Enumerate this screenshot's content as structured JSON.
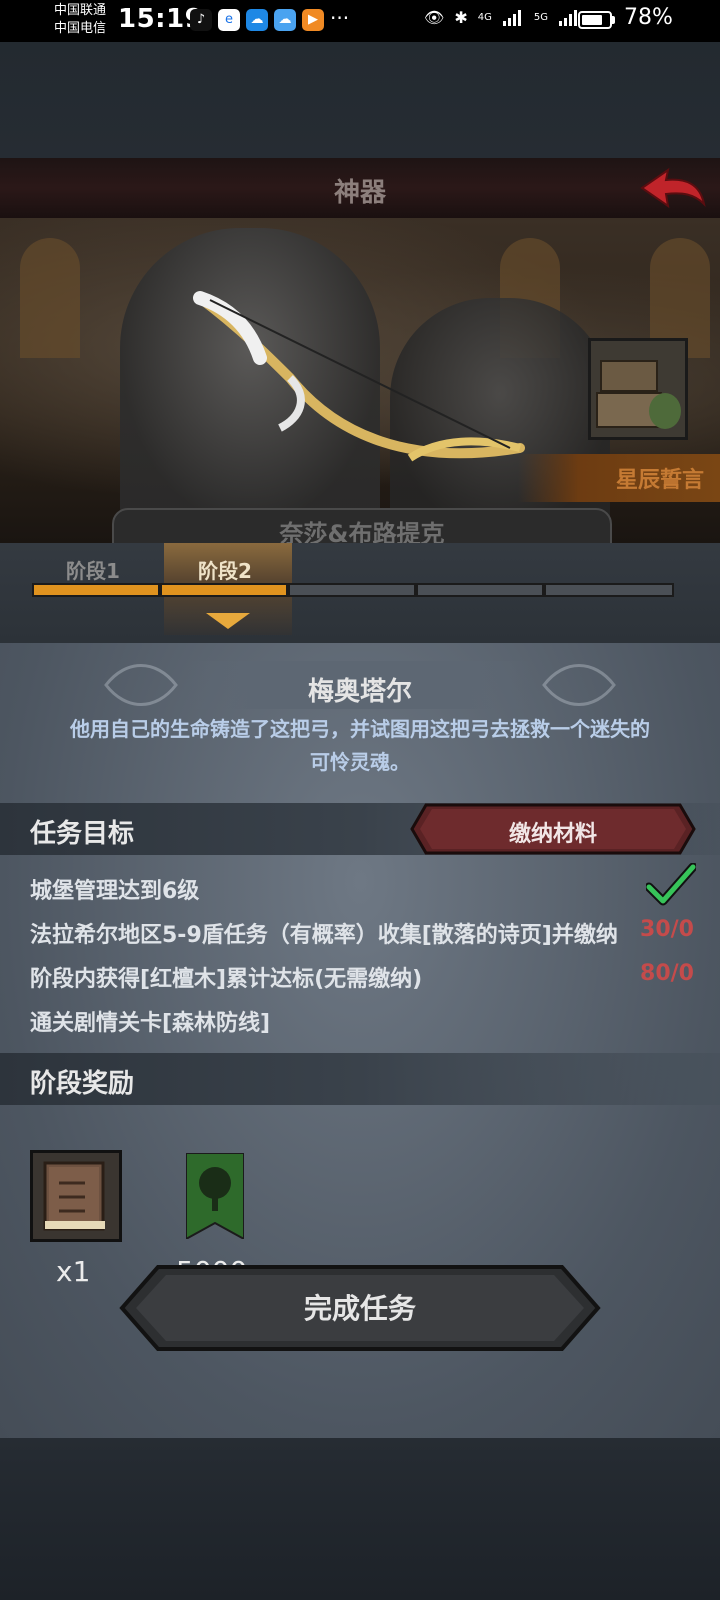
{
  "status_bar": {
    "carrier_1": "中国联通",
    "carrier_2": "中国电信",
    "time": "15:19",
    "battery": "78%",
    "battery_level": 0.78,
    "signal_1": "4G",
    "signal_2": "5G",
    "icons": [
      "tiktok-icon",
      "browser-icon",
      "cloud-app-icon",
      "cloud-drive-icon",
      "video-app-icon",
      "eye-icon",
      "bluetooth-icon",
      "vibrate-icon"
    ]
  },
  "header": {
    "title": "神器",
    "back_icon": "back-arrow-icon",
    "back_color": "#c0242a"
  },
  "hero": {
    "name_plate": "奈莎&布路提克",
    "banner_label": "星辰誓言",
    "chest_icon": "treasure-chest-icon"
  },
  "stages": {
    "tab_1": "阶段1",
    "tab_2": "阶段2",
    "segments_total": 5,
    "segments_done": 2,
    "progress_color": "#e0931f"
  },
  "artifact": {
    "name": "梅奥塔尔",
    "description_line_1": "他用自己的生命铸造了这把弓，并试图用这把弓去拯救一个迷失的",
    "description_line_2": "可怜灵魂。"
  },
  "tasks": {
    "title": "任务目标",
    "submit_button": "缴纳材料",
    "items": [
      {
        "text": "城堡管理达到6级",
        "progress": ""
      },
      {
        "text": "法拉希尔地区5-9盾任务（有概率）收集[散落的诗页]并缴纳",
        "progress": "30/0"
      },
      {
        "text": "阶段内获得[红檀木]累计达标(无需缴纳)",
        "progress": "80/0"
      },
      {
        "text": "通关剧情关卡[森林防线]",
        "progress": ""
      }
    ]
  },
  "rewards": {
    "title": "阶段奖励",
    "items": [
      {
        "icon": "book-icon",
        "count": "x1"
      },
      {
        "icon": "tree-banner-icon",
        "count": "5000"
      }
    ]
  },
  "actions": {
    "complete_button": "完成任务"
  }
}
